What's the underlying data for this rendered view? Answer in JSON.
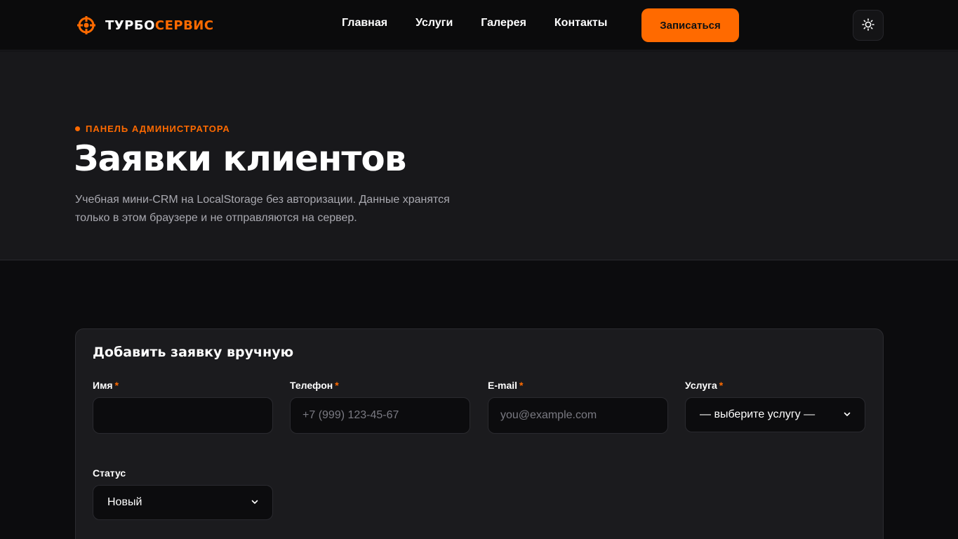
{
  "header": {
    "logo_part1": "ТУРБО",
    "logo_part2": "СЕРВИС",
    "logo_icon": "crosshair-icon",
    "nav": [
      "Главная",
      "Услуги",
      "Галерея",
      "Контакты"
    ],
    "cta_label": "Записаться",
    "theme_icon": "sun-icon"
  },
  "hero": {
    "eyebrow": "ПАНЕЛЬ АДМИНИСТРАТОРА",
    "title": "Заявки клиентов",
    "description": "Учебная мини-CRM на LocalStorage без авторизации. Данные хранятся только в этом браузере и не отправляются на сервер."
  },
  "form": {
    "title": "Добавить заявку вручную",
    "required_mark": "*",
    "name": {
      "label": "Имя",
      "value": "",
      "placeholder": ""
    },
    "phone": {
      "label": "Телефон",
      "value": "",
      "placeholder": "+7 (999) 123-45-67"
    },
    "email": {
      "label": "E-mail",
      "value": "",
      "placeholder": "you@example.com"
    },
    "service": {
      "label": "Услуга",
      "selected": "— выберите услугу —"
    },
    "status": {
      "label": "Статус",
      "selected": "Новый"
    }
  },
  "colors": {
    "accent": "#ff6a00",
    "background": "#0c0c0e",
    "surface": "#1b1b1e"
  }
}
